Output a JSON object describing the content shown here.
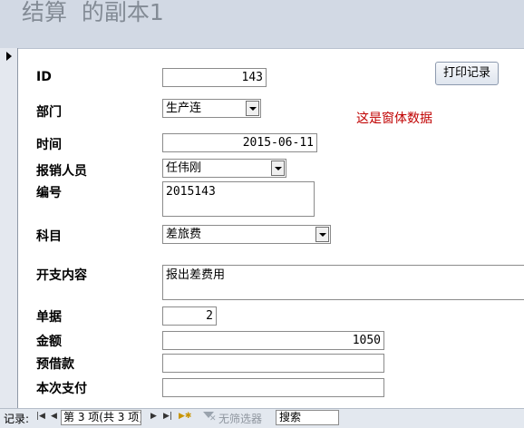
{
  "form_title": "结算  的副本1",
  "print_button": "打印记录",
  "note": "这是窗体数据",
  "fields": {
    "id": {
      "label": "ID",
      "value": "143"
    },
    "dept": {
      "label": "部门",
      "value": "生产连"
    },
    "time": {
      "label": "时间",
      "value": "2015-06-11"
    },
    "claimant": {
      "label": "报销人员",
      "value": "任伟刚"
    },
    "number": {
      "label": "编号",
      "value": "2015143"
    },
    "subject": {
      "label": "科目",
      "value": "差旅费"
    },
    "content": {
      "label": "开支内容",
      "value": "报出差费用"
    },
    "receipts": {
      "label": "单据",
      "value": "2"
    },
    "amount": {
      "label": "金额",
      "value": "1050"
    },
    "advance": {
      "label": "预借款",
      "value": ""
    },
    "payment": {
      "label": "本次支付",
      "value": ""
    }
  },
  "navbar": {
    "records_label": "记录:",
    "record_position": "第 3 项(共 3 项)",
    "no_filter": "无筛选器",
    "search": "搜索"
  }
}
